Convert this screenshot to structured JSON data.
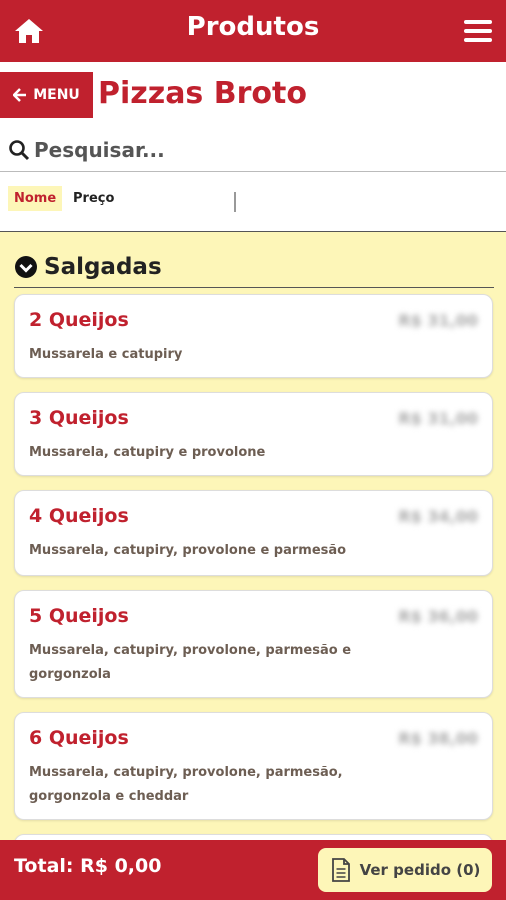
{
  "topbar": {
    "title": "Produtos",
    "home_icon": "home-icon",
    "menu_icon": "hamburger-icon"
  },
  "menu_button": {
    "label": "MENU",
    "icon": "arrow-left-icon"
  },
  "page_title": "Pizzas Broto",
  "search": {
    "placeholder": "Pesquisar...",
    "icon": "search-icon"
  },
  "sort": {
    "tabs": [
      "Nome",
      "Preço"
    ],
    "active": "Nome"
  },
  "section": {
    "label": "Salgadas",
    "icon": "chevron-down-circle-icon"
  },
  "products": [
    {
      "name": "2 Queijos",
      "price": "R$ 31,00",
      "desc": "Mussarela e catupiry"
    },
    {
      "name": "3 Queijos",
      "price": "R$ 31,00",
      "desc": "Mussarela, catupiry e provolone"
    },
    {
      "name": "4 Queijos",
      "price": "R$ 34,00",
      "desc": "Mussarela, catupiry, provolone e parmesão"
    },
    {
      "name": "5 Queijos",
      "price": "R$ 36,00",
      "desc": "Mussarela, catupiry, provolone, parmesão e gorgonzola"
    },
    {
      "name": "6 Queijos",
      "price": "R$ 38,00",
      "desc": "Mussarela, catupiry, provolone, parmesão, gorgonzola e cheddar"
    }
  ],
  "footer": {
    "total": "Total: R$ 0,00",
    "order_button": "Ver pedido (0)",
    "order_icon": "document-icon"
  },
  "colors": {
    "brand": "#c0212e",
    "background": "#fdf6b8"
  }
}
